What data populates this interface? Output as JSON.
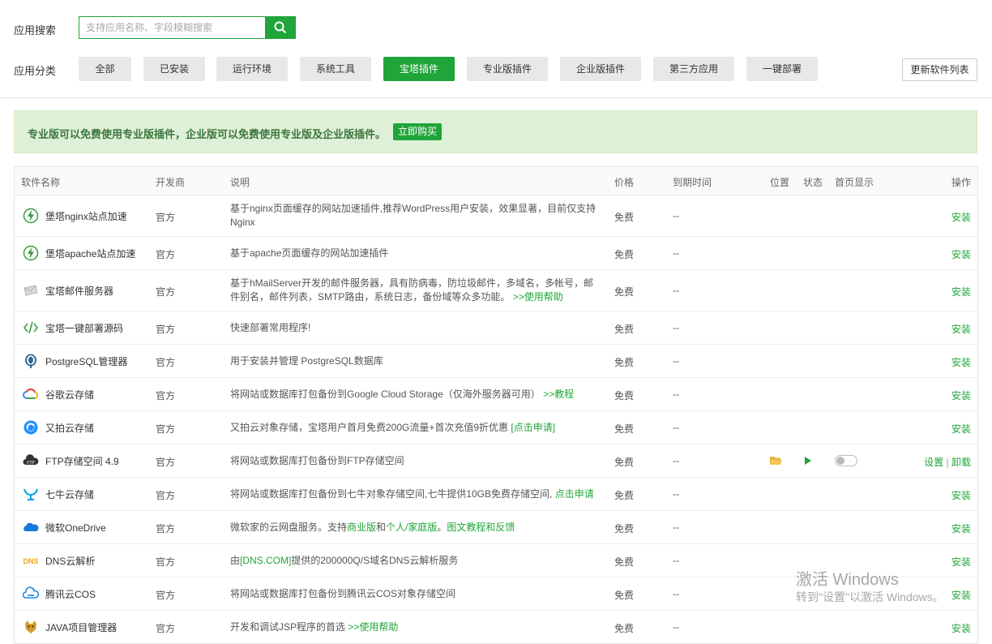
{
  "search": {
    "label": "应用搜索",
    "placeholder": "支持应用名称、字段模糊搜索"
  },
  "category": {
    "label": "应用分类",
    "items": [
      "全部",
      "已安装",
      "运行环境",
      "系统工具",
      "宝塔插件",
      "专业版插件",
      "企业版插件",
      "第三方应用",
      "一键部署"
    ],
    "active": "宝塔插件"
  },
  "update_button": "更新软件列表",
  "notice": {
    "text": "专业版可以免费使用专业版插件，企业版可以免费使用专业版及企业版插件。",
    "buy": "立即购买"
  },
  "table": {
    "headers": {
      "name": "软件名称",
      "vendor": "开发商",
      "desc": "说明",
      "price": "价格",
      "expire": "到期时间",
      "position": "位置",
      "status": "状态",
      "home": "首页显示",
      "action": "操作"
    },
    "rows": [
      {
        "name": "堡塔nginx站点加速",
        "vendor": "官方",
        "desc": "基于nginx页面缓存的网站加速插件,推荐WordPress用户安装，效果显著，目前仅支持Nginx",
        "price": "免费",
        "expire": "--",
        "action": "安装",
        "icon": "lightning-icon"
      },
      {
        "name": "堡塔apache站点加速",
        "vendor": "官方",
        "desc": "基于apache页面缓存的网站加速插件",
        "price": "免费",
        "expire": "--",
        "action": "安装",
        "icon": "lightning-icon"
      },
      {
        "name": "宝塔邮件服务器",
        "vendor": "官方",
        "desc": "基于hMailServer开发的邮件服务器，具有防病毒，防垃圾邮件，多域名，多帐号，邮件别名，邮件列表，SMTP路由，系统日志，备份域等众多功能。",
        "desc_link": ">>使用帮助",
        "price": "免费",
        "expire": "--",
        "action": "安装",
        "icon": "mail-icon"
      },
      {
        "name": "宝塔一键部署源码",
        "vendor": "官方",
        "desc": "快速部署常用程序!",
        "price": "免费",
        "expire": "--",
        "action": "安装",
        "icon": "code-icon"
      },
      {
        "name": "PostgreSQL管理器",
        "vendor": "官方",
        "desc": "用于安装并管理 PostgreSQL数据库",
        "price": "免费",
        "expire": "--",
        "action": "安装",
        "icon": "postgresql-icon"
      },
      {
        "name": "谷歌云存储",
        "vendor": "官方",
        "desc": "将网站或数据库打包备份到Google Cloud Storage（仅海外服务器可用）",
        "desc_link": ">>教程",
        "price": "免费",
        "expire": "--",
        "action": "安装",
        "icon": "google-cloud-icon"
      },
      {
        "name": "又拍云存储",
        "vendor": "官方",
        "desc": "又拍云对象存储，宝塔用户首月免费200G流量+首次充值9折优惠",
        "desc_link": "[点击申请]",
        "price": "免费",
        "expire": "--",
        "action": "安装",
        "icon": "upyun-icon"
      },
      {
        "name": "FTP存储空间 4.9",
        "vendor": "官方",
        "desc": "将网站或数据库打包备份到FTP存储空间",
        "price": "免费",
        "expire": "--",
        "action_settings": "设置",
        "action_sep": "|",
        "action_uninstall": "卸载",
        "icon": "ftp-icon",
        "installed": true
      },
      {
        "name": "七牛云存储",
        "vendor": "官方",
        "desc": "将网站或数据库打包备份到七牛对象存储空间,七牛提供10GB免费存储空间,",
        "desc_link": "点击申请",
        "price": "免费",
        "expire": "--",
        "action": "安装",
        "icon": "qiniu-icon"
      },
      {
        "name": "微软OneDrive",
        "vendor": "官方",
        "desc": "微软家的云网盘服务。支持",
        "desc_link": "商业版",
        "desc_mid": "和",
        "desc_link2": "个人/家庭版",
        "desc_mid2": "。",
        "desc_link3": "图文教程和反馈",
        "price": "免费",
        "expire": "--",
        "action": "安装",
        "icon": "onedrive-icon"
      },
      {
        "name": "DNS云解析",
        "vendor": "官方",
        "desc_pre": "由",
        "desc_link": "[DNS.COM]",
        "desc": "提供的200000Q/S域名DNS云解析服务",
        "price": "免费",
        "expire": "--",
        "action": "安装",
        "icon": "dns-icon"
      },
      {
        "name": "腾讯云COS",
        "vendor": "官方",
        "desc": "将网站或数据库打包备份到腾讯云COS对象存储空间",
        "price": "免费",
        "expire": "--",
        "action": "安装",
        "icon": "tencent-cloud-icon"
      },
      {
        "name": "JAVA项目管理器",
        "vendor": "官方",
        "desc": "开发和调试JSP程序的首选",
        "desc_link": ">>使用帮助",
        "price": "免费",
        "expire": "--",
        "action": "安装",
        "icon": "tomcat-icon"
      }
    ]
  },
  "watermark": {
    "line1": "激活 Windows",
    "line2": "转到\"设置\"以激活 Windows。"
  },
  "colors": {
    "accent": "#20a53a",
    "notice_bg": "#dff0d8"
  }
}
